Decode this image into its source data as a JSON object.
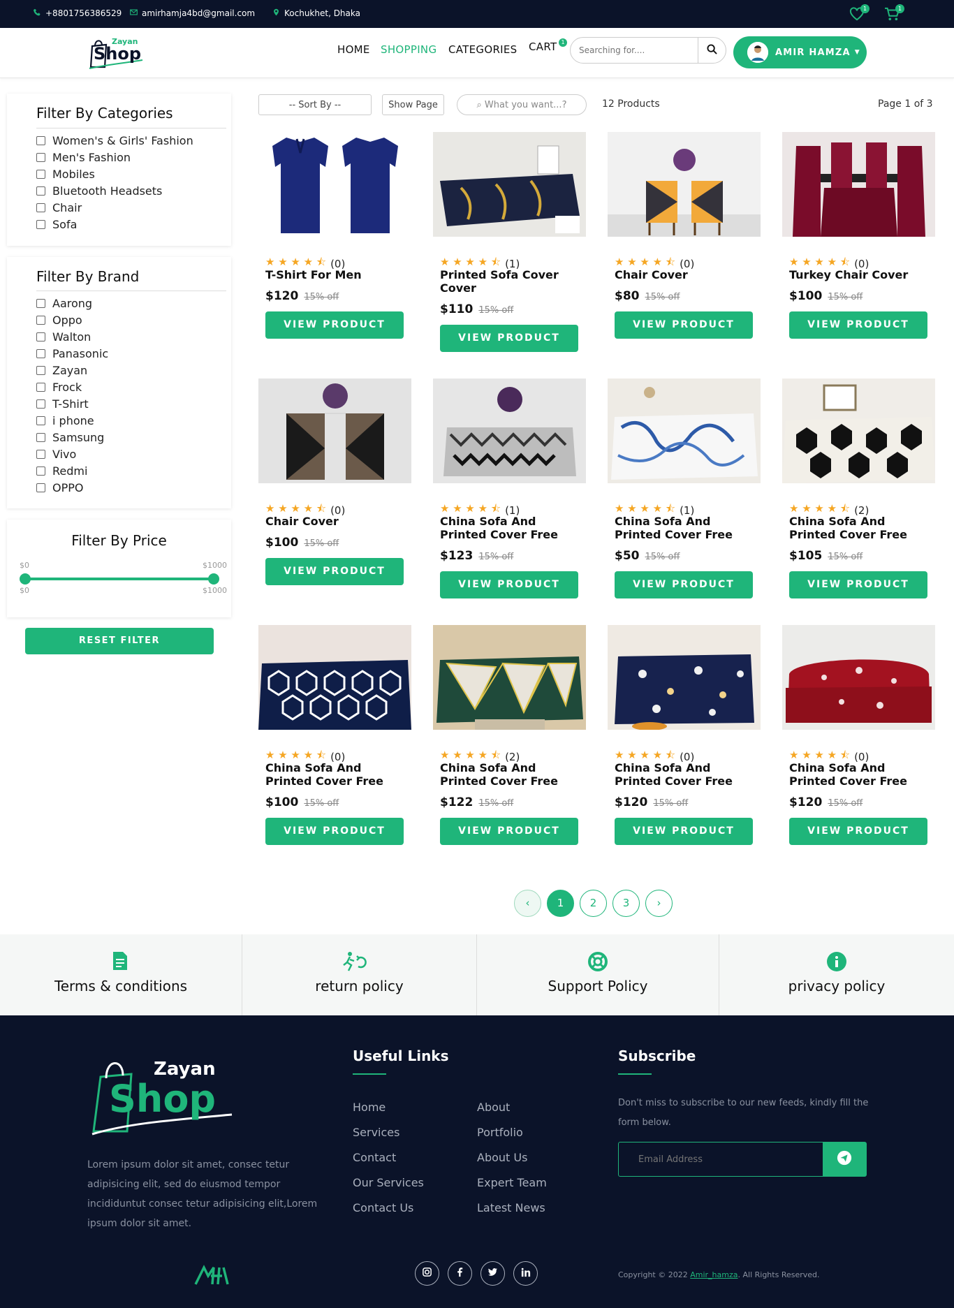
{
  "topbar": {
    "phone": "+8801756386529",
    "email": "amirhamja4bd@gmail.com",
    "location": "Kochukhet, Dhaka",
    "wishlist_count": "1",
    "cart_count": "1"
  },
  "brand": {
    "logo_small": "Zayan",
    "logo_big": "Shop",
    "accent_color": "#1fb57a",
    "dark_color": "#0b1329"
  },
  "nav": {
    "home": "HOME",
    "shopping": "SHOPPING",
    "categories": "CATEGORIES",
    "cart": "CART",
    "cart_count": "1",
    "search_placeholder": "Searching for....",
    "user": "AMIR HAMZA"
  },
  "filters": {
    "categories_title": "Filter By Categories",
    "categories": [
      "Women's & Girls' Fashion",
      "Men's Fashion",
      "Mobiles",
      "Bluetooth Headsets",
      "Chair",
      "Sofa"
    ],
    "brand_title": "Filter By Brand",
    "brands": [
      "Aarong",
      "Oppo",
      "Walton",
      "Panasonic",
      "Zayan",
      "Frock",
      "T-Shirt",
      "i phone",
      "Samsung",
      "Vivo",
      "Redmi",
      "OPPO"
    ],
    "price_title": "Filter By Price",
    "price_min": "$0",
    "price_max": "$1000",
    "reset": "RESET FILTER"
  },
  "toolbar": {
    "sort": "-- Sort By --",
    "show_page": "Show Page",
    "search_placeholder": "⌕ What you want...?",
    "product_count": "12 Products",
    "page_info": "Page 1 of 3"
  },
  "products": [
    {
      "title": "T-Shirt For Men",
      "rating": "(0)",
      "price": "$120",
      "discount": "15% off",
      "button": "VIEW PRODUCT"
    },
    {
      "title": "Printed Sofa Cover Cover",
      "rating": "(1)",
      "price": "$110",
      "discount": "15% off",
      "button": "VIEW PRODUCT"
    },
    {
      "title": "Chair Cover",
      "rating": "(0)",
      "price": "$80",
      "discount": "15% off",
      "button": "VIEW PRODUCT"
    },
    {
      "title": "Turkey Chair Cover",
      "rating": "(0)",
      "price": "$100",
      "discount": "15% off",
      "button": "VIEW PRODUCT"
    },
    {
      "title": "Chair Cover",
      "rating": "(0)",
      "price": "$100",
      "discount": "15% off",
      "button": "VIEW PRODUCT"
    },
    {
      "title": "China Sofa And Printed Cover Free",
      "rating": "(1)",
      "price": "$123",
      "discount": "15% off",
      "button": "VIEW PRODUCT"
    },
    {
      "title": "China Sofa And Printed Cover Free",
      "rating": "(1)",
      "price": "$50",
      "discount": "15% off",
      "button": "VIEW PRODUCT"
    },
    {
      "title": "China Sofa And Printed Cover Free",
      "rating": "(2)",
      "price": "$105",
      "discount": "15% off",
      "button": "VIEW PRODUCT"
    },
    {
      "title": "China Sofa And Printed Cover Free",
      "rating": "(0)",
      "price": "$100",
      "discount": "15% off",
      "button": "VIEW PRODUCT"
    },
    {
      "title": "China Sofa And Printed Cover Free",
      "rating": "(2)",
      "price": "$122",
      "discount": "15% off",
      "button": "VIEW PRODUCT"
    },
    {
      "title": "China Sofa And Printed Cover Free",
      "rating": "(0)",
      "price": "$120",
      "discount": "15% off",
      "button": "VIEW PRODUCT"
    },
    {
      "title": "China Sofa And Printed Cover Free",
      "rating": "(0)",
      "price": "$120",
      "discount": "15% off",
      "button": "VIEW PRODUCT"
    }
  ],
  "pagination": {
    "prev": "‹",
    "pages": [
      "1",
      "2",
      "3"
    ],
    "next": "›"
  },
  "policies": [
    "Terms & conditions",
    "return policy",
    "Support Policy",
    "privacy policy"
  ],
  "footer": {
    "logo_small": "Zayan",
    "logo_big": "Shop",
    "about": "Lorem ipsum dolor sit amet, consec tetur adipisicing elit, sed do eiusmod tempor incididuntut consec tetur adipisicing elit,Lorem ipsum dolor sit amet.",
    "links_title": "Useful Links",
    "links_col1": [
      "Home",
      "Services",
      "Contact",
      "Our Services",
      "Contact Us"
    ],
    "links_col2": [
      "About",
      "Portfolio",
      "About Us",
      "Expert Team",
      "Latest News"
    ],
    "subscribe_title": "Subscribe",
    "subscribe_text": "Don't miss to subscribe to our new feeds, kindly fill the form below.",
    "email_placeholder": "Email Address",
    "copyright_prefix": "Copyright © 2022 ",
    "copyright_link": "Amir_hamza",
    "copyright_suffix": ". All Rights Reserved."
  }
}
